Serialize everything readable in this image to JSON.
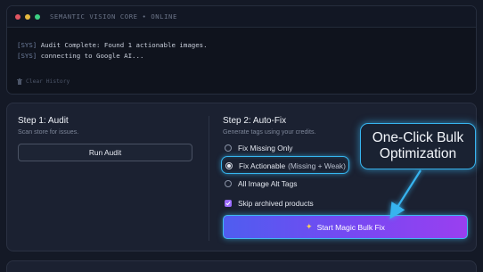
{
  "terminal": {
    "title": "SEMANTIC VISION CORE • ONLINE",
    "logs": [
      {
        "tag": "[SYS]",
        "text": " Audit Complete: Found 1 actionable images."
      },
      {
        "tag": "[SYS]",
        "text": " connecting to Google AI..."
      }
    ],
    "clear_label": "Clear History",
    "dot_colors": [
      "#e05561",
      "#e5b93f",
      "#3ccf83"
    ]
  },
  "step1": {
    "title": "Step 1: Audit",
    "subtitle": "Scan store for issues.",
    "button_label": "Run Audit"
  },
  "step2": {
    "title": "Step 2: Auto-Fix",
    "subtitle": "Generate tags using your credits.",
    "options": [
      {
        "label": "Fix Missing Only",
        "note": "",
        "checked": false
      },
      {
        "label": "Fix Actionable",
        "note": "(Missing + Weak)",
        "checked": true
      },
      {
        "label": "All Image Alt Tags",
        "note": "",
        "checked": false
      }
    ],
    "skip_archived_label": "Skip archived products",
    "skip_archived_checked": true,
    "button_label": "Start Magic Bulk Fix",
    "button_icon": "sparkle-icon"
  },
  "callout": {
    "line1": "One-Click Bulk",
    "line2": "Optimization",
    "accent": "#37b4ef"
  },
  "colors": {
    "background": "#141926",
    "panel": "#1b2131",
    "gradient_start": "#4f5df0",
    "gradient_end": "#9a3ff0",
    "highlight": "#36b6f0"
  }
}
